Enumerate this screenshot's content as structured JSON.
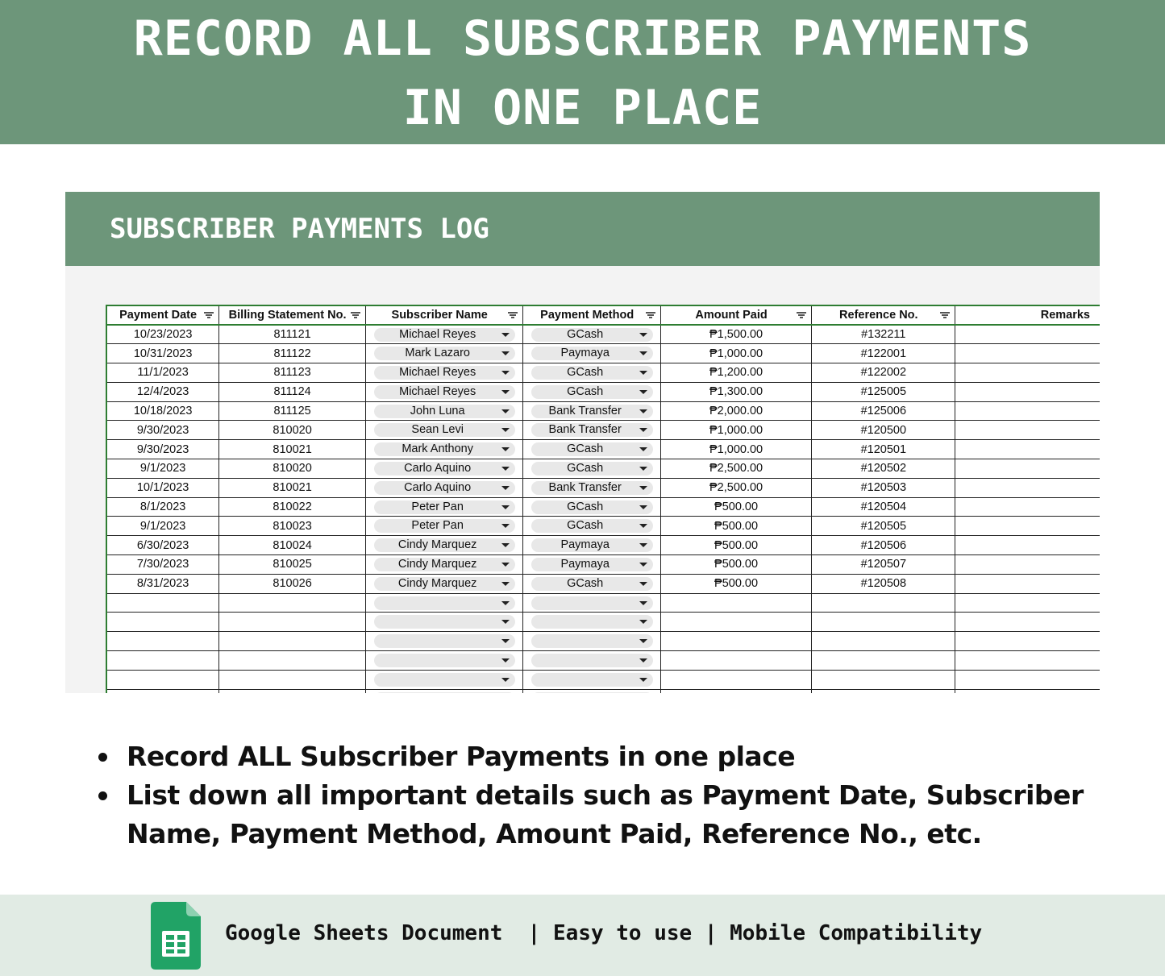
{
  "banner": {
    "line1": "RECORD ALL SUBSCRIBER PAYMENTS",
    "line2": "IN ONE PLACE"
  },
  "sheet": {
    "title": "SUBSCRIBER PAYMENTS LOG",
    "columns": [
      {
        "label": "Payment Date",
        "filter_icon": "filter-icon"
      },
      {
        "label": "Billing Statement No.",
        "filter_icon": "filter-icon"
      },
      {
        "label": "Subscriber Name",
        "filter_icon": "filter-icon"
      },
      {
        "label": "Payment Method",
        "filter_icon": "filter-icon"
      },
      {
        "label": "Amount Paid",
        "filter_icon": "filter-icon"
      },
      {
        "label": "Reference No.",
        "filter_icon": "filter-icon"
      },
      {
        "label": "Remarks"
      }
    ],
    "rows": [
      {
        "date": "10/23/2023",
        "billing": "811121",
        "name": "Michael Reyes",
        "method": "GCash",
        "amount": "₱1,500.00",
        "ref": "#132211",
        "remarks": ""
      },
      {
        "date": "10/31/2023",
        "billing": "811122",
        "name": "Mark Lazaro",
        "method": "Paymaya",
        "amount": "₱1,000.00",
        "ref": "#122001",
        "remarks": ""
      },
      {
        "date": "11/1/2023",
        "billing": "811123",
        "name": "Michael Reyes",
        "method": "GCash",
        "amount": "₱1,200.00",
        "ref": "#122002",
        "remarks": ""
      },
      {
        "date": "12/4/2023",
        "billing": "811124",
        "name": "Michael Reyes",
        "method": "GCash",
        "amount": "₱1,300.00",
        "ref": "#125005",
        "remarks": ""
      },
      {
        "date": "10/18/2023",
        "billing": "811125",
        "name": "John Luna",
        "method": "Bank Transfer",
        "amount": "₱2,000.00",
        "ref": "#125006",
        "remarks": ""
      },
      {
        "date": "9/30/2023",
        "billing": "810020",
        "name": "Sean Levi",
        "method": "Bank Transfer",
        "amount": "₱1,000.00",
        "ref": "#120500",
        "remarks": ""
      },
      {
        "date": "9/30/2023",
        "billing": "810021",
        "name": "Mark Anthony",
        "method": "GCash",
        "amount": "₱1,000.00",
        "ref": "#120501",
        "remarks": ""
      },
      {
        "date": "9/1/2023",
        "billing": "810020",
        "name": "Carlo Aquino",
        "method": "GCash",
        "amount": "₱2,500.00",
        "ref": "#120502",
        "remarks": ""
      },
      {
        "date": "10/1/2023",
        "billing": "810021",
        "name": "Carlo Aquino",
        "method": "Bank Transfer",
        "amount": "₱2,500.00",
        "ref": "#120503",
        "remarks": ""
      },
      {
        "date": "8/1/2023",
        "billing": "810022",
        "name": "Peter Pan",
        "method": "GCash",
        "amount": "₱500.00",
        "ref": "#120504",
        "remarks": ""
      },
      {
        "date": "9/1/2023",
        "billing": "810023",
        "name": "Peter Pan",
        "method": "GCash",
        "amount": "₱500.00",
        "ref": "#120505",
        "remarks": ""
      },
      {
        "date": "6/30/2023",
        "billing": "810024",
        "name": "Cindy Marquez",
        "method": "Paymaya",
        "amount": "₱500.00",
        "ref": "#120506",
        "remarks": ""
      },
      {
        "date": "7/30/2023",
        "billing": "810025",
        "name": "Cindy Marquez",
        "method": "Paymaya",
        "amount": "₱500.00",
        "ref": "#120507",
        "remarks": ""
      },
      {
        "date": "8/31/2023",
        "billing": "810026",
        "name": "Cindy Marquez",
        "method": "GCash",
        "amount": "₱500.00",
        "ref": "#120508",
        "remarks": ""
      },
      {
        "date": "",
        "billing": "",
        "name": "",
        "method": "",
        "amount": "",
        "ref": "",
        "remarks": ""
      },
      {
        "date": "",
        "billing": "",
        "name": "",
        "method": "",
        "amount": "",
        "ref": "",
        "remarks": ""
      },
      {
        "date": "",
        "billing": "",
        "name": "",
        "method": "",
        "amount": "",
        "ref": "",
        "remarks": ""
      },
      {
        "date": "",
        "billing": "",
        "name": "",
        "method": "",
        "amount": "",
        "ref": "",
        "remarks": ""
      },
      {
        "date": "",
        "billing": "",
        "name": "",
        "method": "",
        "amount": "",
        "ref": "",
        "remarks": ""
      },
      {
        "date": "",
        "billing": "",
        "name": "",
        "method": "",
        "amount": "",
        "ref": "",
        "remarks": ""
      }
    ]
  },
  "bullets": [
    "Record ALL Subscriber Payments in one place",
    "List down all important details such as Payment Date, Subscriber Name, Payment Method, Amount Paid, Reference No., etc."
  ],
  "footer": {
    "logo_icon": "google-sheets-icon",
    "text": "Google Sheets Document  | Easy to use | Mobile Compatibility"
  },
  "colors": {
    "banner_green": "#6d967a",
    "footer_bg": "#e1ebe4",
    "sheets_green": "#21a366"
  }
}
